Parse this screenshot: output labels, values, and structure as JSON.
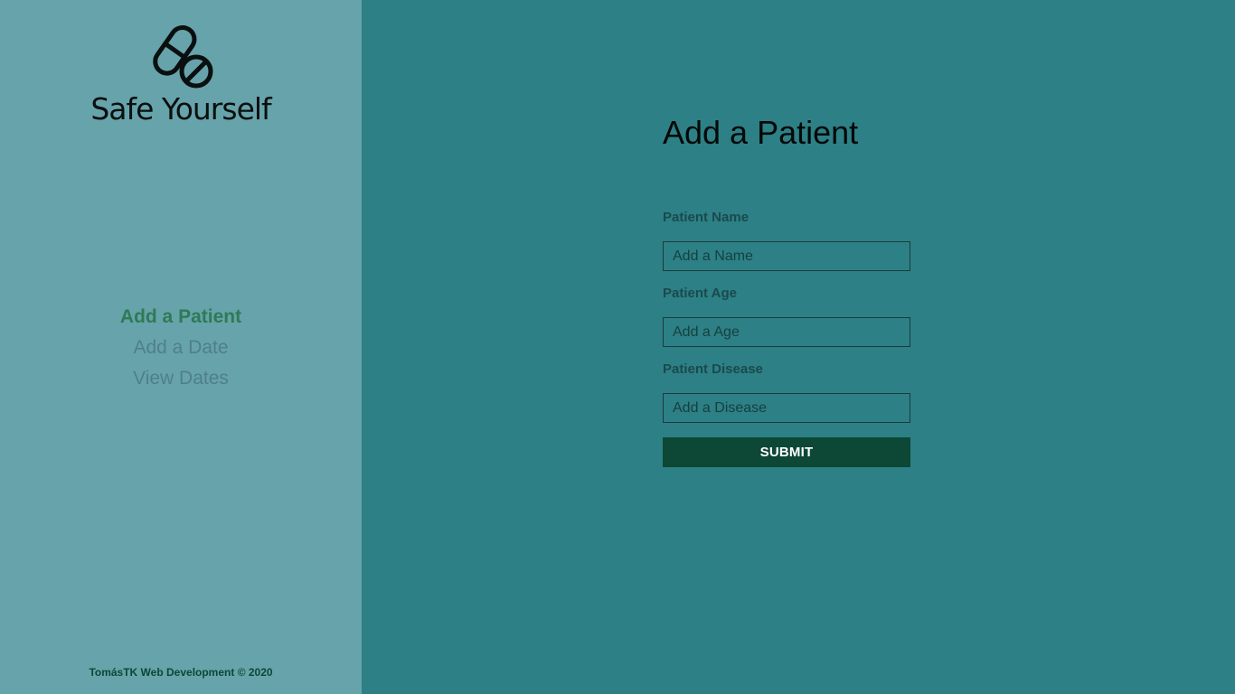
{
  "brand": {
    "name": "Safe Yourself",
    "icon": "pill-prohibited-icon"
  },
  "sidebar": {
    "nav_items": [
      {
        "label": "Add a Patient",
        "active": true
      },
      {
        "label": "Add a Date",
        "active": false
      },
      {
        "label": "View Dates",
        "active": false
      }
    ],
    "footer": "TomásTK Web Development © 2020"
  },
  "form": {
    "title": "Add a Patient",
    "fields": [
      {
        "label": "Patient Name",
        "placeholder": "Add a Name",
        "value": ""
      },
      {
        "label": "Patient Age",
        "placeholder": "Add a Age",
        "value": ""
      },
      {
        "label": "Patient Disease",
        "placeholder": "Add a Disease",
        "value": ""
      }
    ],
    "submit_label": "SUBMIT"
  },
  "colors": {
    "sidebar_bg": "#67a3aa",
    "main_bg": "#2d8085",
    "nav_active": "#2e7a56",
    "nav_inactive": "#4f7f8a",
    "button_bg": "#0d4735"
  }
}
